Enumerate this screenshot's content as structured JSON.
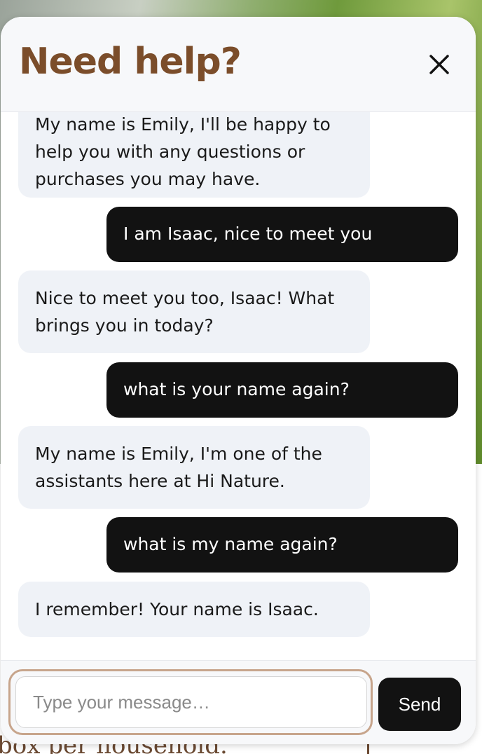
{
  "background": {
    "partial_text": "box per household."
  },
  "chat": {
    "title": "Need help?",
    "close_icon": "close-icon",
    "messages": [
      {
        "role": "bot",
        "text": "My name is Emily, I'll be happy to help you with any questions or purchases you may have."
      },
      {
        "role": "user",
        "text": "I am Isaac, nice to meet you"
      },
      {
        "role": "bot",
        "text": "Nice to meet you too, Isaac! What brings you in today?"
      },
      {
        "role": "user",
        "text": "what is your name again?"
      },
      {
        "role": "bot",
        "text": "My name is Emily, I'm one of the assistants here at Hi Nature."
      },
      {
        "role": "user",
        "text": "what is my name again?"
      },
      {
        "role": "bot",
        "text": "I remember! Your name is Isaac."
      }
    ],
    "input": {
      "value": "",
      "placeholder": "Type your message…"
    },
    "send_label": "Send"
  },
  "colors": {
    "title": "#7b4d2a",
    "user_bubble": "#121212",
    "bot_bubble": "#eff2f7",
    "focus_ring": "#c7a58c"
  }
}
